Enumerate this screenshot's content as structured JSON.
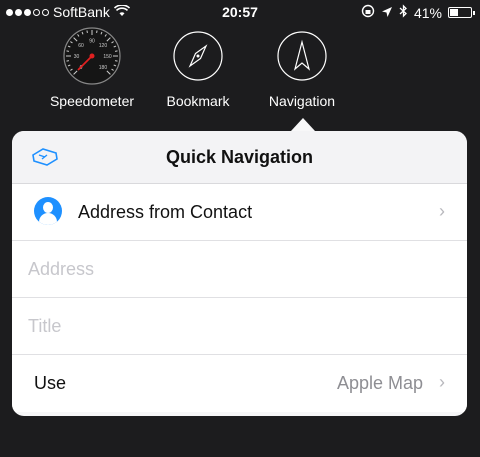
{
  "status_bar": {
    "carrier": "SoftBank",
    "time": "20:57",
    "battery_percent": "41%",
    "battery_level": 0.41
  },
  "toolbar": {
    "speedometer_label": "Speedometer",
    "bookmark_label": "Bookmark",
    "navigation_label": "Navigation",
    "gauge_numbers": [
      "0",
      "30",
      "60",
      "90",
      "120",
      "150",
      "180"
    ]
  },
  "popover": {
    "title": "Quick Navigation",
    "address_from_contact_label": "Address from Contact",
    "address_placeholder": "Address",
    "title_placeholder": "Title",
    "use_label": "Use",
    "use_value": "Apple Map"
  },
  "colors": {
    "background": "#1c1c1e",
    "accent": "#1e90ff",
    "gauge_needle": "#e02020"
  }
}
